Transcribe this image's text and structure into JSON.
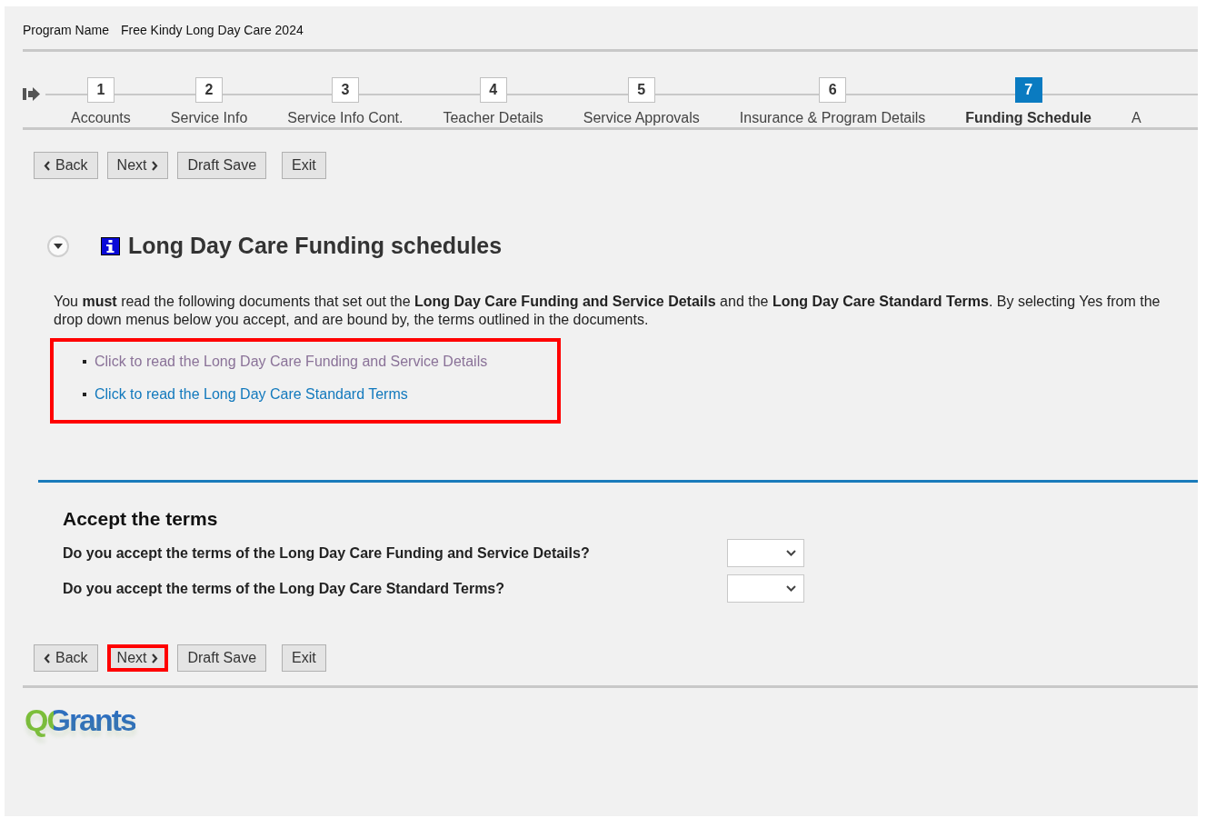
{
  "program": {
    "label": "Program Name",
    "value": "Free Kindy Long Day Care 2024"
  },
  "steps": [
    {
      "number": "1",
      "label": "Accounts",
      "selected": false
    },
    {
      "number": "2",
      "label": "Service Info",
      "selected": false
    },
    {
      "number": "3",
      "label": "Service Info Cont.",
      "selected": false
    },
    {
      "number": "4",
      "label": "Teacher Details",
      "selected": false
    },
    {
      "number": "5",
      "label": "Service Approvals",
      "selected": false
    },
    {
      "number": "6",
      "label": "Insurance & Program Details",
      "selected": false
    },
    {
      "number": "7",
      "label": "Funding Schedule",
      "selected": true
    },
    {
      "label": "A",
      "selected": false
    }
  ],
  "top_buttons": [
    {
      "kind": "back",
      "label": "Back",
      "highlighted": false
    },
    {
      "kind": "next",
      "label": "Next",
      "highlighted": false
    },
    {
      "kind": "plain",
      "label": "Draft Save",
      "highlighted": false
    },
    {
      "kind": "exit",
      "label": "Exit",
      "highlighted": false
    }
  ],
  "section": {
    "title": "Long Day Care Funding schedules",
    "expanded": true,
    "intro": "You **must** read the following documents that set out the **Long Day Care Funding and Service Details** and the **Long Day Care Standard Terms**. By selecting Yes from the drop down menus below you accept, and are bound by, the terms outlined in the documents.",
    "links_highlighted": true,
    "links": [
      {
        "label": "Click to read the Long Day Care Funding and Service Details",
        "visited": true
      },
      {
        "label": "Click to read the Long Day Care Standard Terms",
        "visited": false
      }
    ]
  },
  "accept": {
    "title": "Accept the terms",
    "questions": [
      {
        "label": "Do you accept the terms of the Long Day Care Funding and Service Details?"
      },
      {
        "label": "Do you accept the terms of the Long Day Care Standard Terms?"
      }
    ]
  },
  "bottom_buttons": [
    {
      "kind": "back",
      "label": "Back",
      "highlighted": false
    },
    {
      "kind": "next",
      "label": "Next",
      "highlighted": true
    },
    {
      "kind": "plain",
      "label": "Draft Save",
      "highlighted": false
    },
    {
      "kind": "exit",
      "label": "Exit",
      "highlighted": false
    }
  ],
  "logo": "QGrants"
}
